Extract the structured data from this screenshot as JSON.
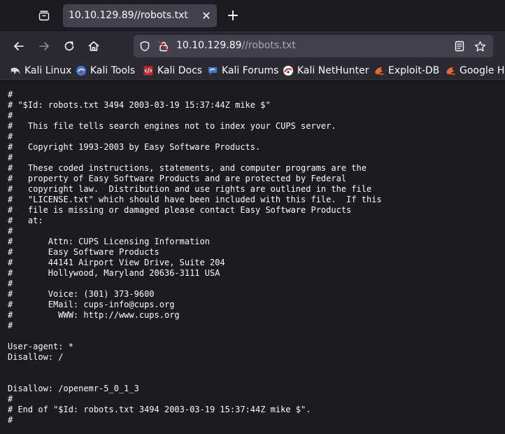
{
  "tab": {
    "title": "10.10.129.89//robots.txt",
    "close_glyph": "✕",
    "new_tab_glyph": "+"
  },
  "urlbar": {
    "host": "10.10.129.89",
    "path": "//robots.txt"
  },
  "bookmarks": [
    {
      "label": "Kali Linux",
      "icon": "kali-dragon-icon"
    },
    {
      "label": "Kali Tools",
      "icon": "kali-tools-icon"
    },
    {
      "label": "Kali Docs",
      "icon": "kali-docs-icon"
    },
    {
      "label": "Kali Forums",
      "icon": "kali-forums-icon"
    },
    {
      "label": "Kali NetHunter",
      "icon": "kali-nethunter-icon"
    },
    {
      "label": "Exploit-DB",
      "icon": "exploit-db-icon"
    },
    {
      "label": "Google Hacking DB",
      "icon": "google-hacking-db-icon"
    }
  ],
  "colors": {
    "accent_red": "#e2252b",
    "chrome_bg": "#2b2a33",
    "page_bg": "#1c1b22",
    "exploitdb_orange": "#e8692b"
  },
  "robots_txt": "#\n# \"$Id: robots.txt 3494 2003-03-19 15:37:44Z mike $\"\n#\n#   This file tells search engines not to index your CUPS server.\n#\n#   Copyright 1993-2003 by Easy Software Products.\n#\n#   These coded instructions, statements, and computer programs are the\n#   property of Easy Software Products and are protected by Federal\n#   copyright law.  Distribution and use rights are outlined in the file\n#   \"LICENSE.txt\" which should have been included with this file.  If this\n#   file is missing or damaged please contact Easy Software Products\n#   at:\n#\n#       Attn: CUPS Licensing Information\n#       Easy Software Products\n#       44141 Airport View Drive, Suite 204\n#       Hollywood, Maryland 20636-3111 USA\n#\n#       Voice: (301) 373-9600\n#       EMail: cups-info@cups.org\n#         WWW: http://www.cups.org\n#\n\nUser-agent: *\nDisallow: /\n\n\nDisallow: /openemr-5_0_1_3\n#\n# End of \"$Id: robots.txt 3494 2003-03-19 15:37:44Z mike $\".\n#"
}
